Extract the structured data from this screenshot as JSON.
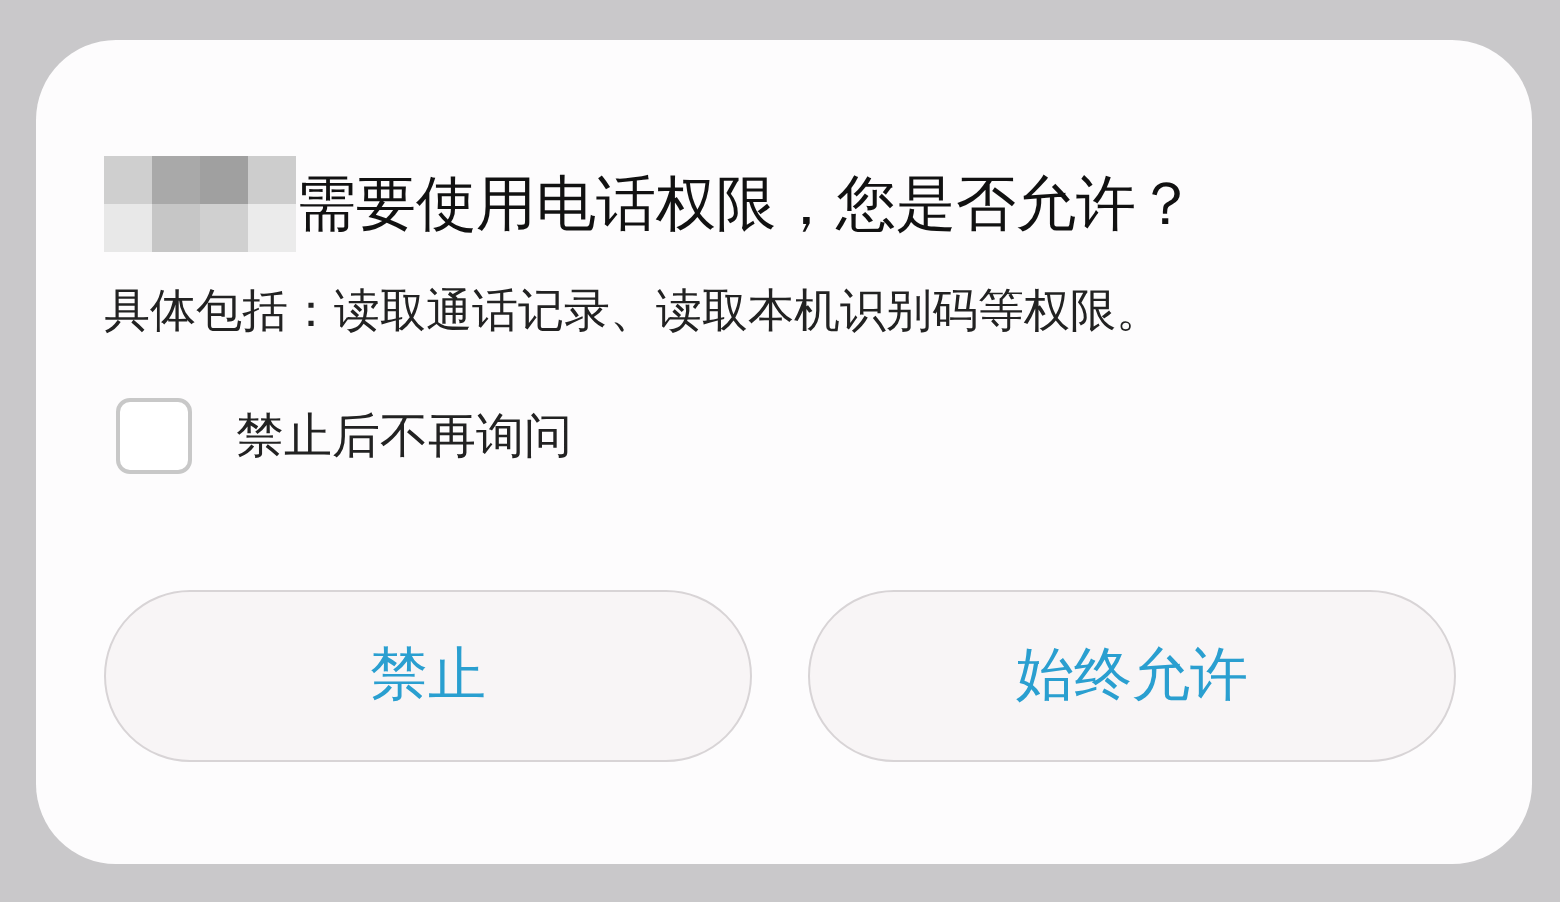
{
  "dialog": {
    "title": "需要使用电话权限，您是否允许？",
    "detail": "具体包括：读取通话记录、读取本机识别码等权限。",
    "option": {
      "label": "禁止后不再询问",
      "checked": false
    },
    "buttons": [
      "禁止",
      "始终允许"
    ]
  }
}
